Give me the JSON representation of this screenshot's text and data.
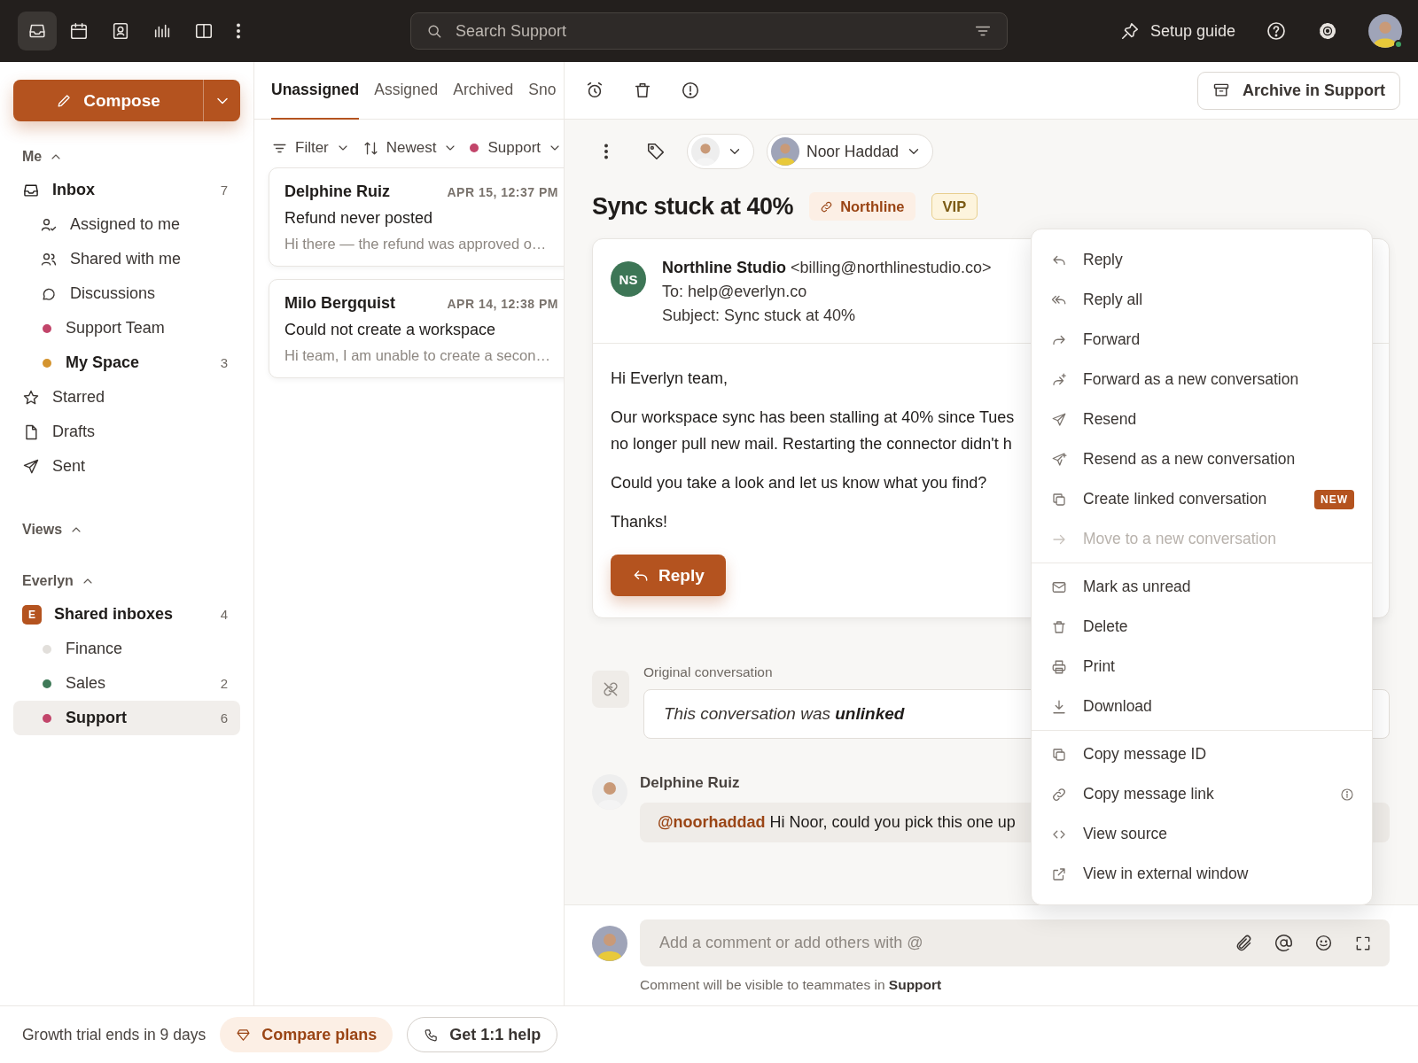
{
  "topbar": {
    "nav": [
      {
        "selected": true
      },
      {
        "selected": false
      },
      {
        "selected": false
      },
      {
        "selected": false
      },
      {
        "selected": false
      }
    ],
    "search": {
      "placeholder": "Search Support"
    },
    "setup_guide": "Setup guide",
    "user": {
      "online": true
    }
  },
  "compose": {
    "label": "Compose"
  },
  "sidebar": {
    "sections": [
      {
        "title": "Me",
        "expanded": true,
        "items": [
          {
            "label": "Inbox",
            "count": "7",
            "unread": true,
            "selected": false,
            "children": [
              {
                "label": "Assigned to me",
                "unread": false,
                "selected": false
              },
              {
                "label": "Shared with me",
                "unread": false,
                "selected": false
              },
              {
                "label": "Discussions",
                "unread": false,
                "selected": false
              },
              {
                "label": "Support Team",
                "color": "#c2456a",
                "unread": false,
                "selected": false
              },
              {
                "label": "My Space",
                "color": "#d4942f",
                "count": "3",
                "unread": true,
                "selected": false
              }
            ]
          },
          {
            "label": "Starred",
            "unread": false,
            "selected": false
          },
          {
            "label": "Drafts",
            "unread": false,
            "selected": false
          },
          {
            "label": "Sent",
            "unread": false,
            "selected": false
          }
        ]
      },
      {
        "title": "Views",
        "expanded": true
      },
      {
        "title": "Everlyn",
        "expanded": true,
        "items": [
          {
            "label": "Shared inboxes",
            "badge": "E",
            "count": "4",
            "unread": true,
            "selected": false,
            "children": [
              {
                "label": "Finance",
                "color": "#e2dfdb",
                "unread": false,
                "selected": false
              },
              {
                "label": "Sales",
                "color": "#3f7a58",
                "count": "2",
                "unread": false,
                "selected": false
              },
              {
                "label": "Support",
                "color": "#c2456a",
                "count": "6",
                "unread": true,
                "selected": true
              }
            ]
          }
        ]
      }
    ]
  },
  "list": {
    "tabs": [
      {
        "label": "Unassigned",
        "selected": true
      },
      {
        "label": "Assigned",
        "selected": false
      },
      {
        "label": "Archived",
        "selected": false
      },
      {
        "label": "Sno",
        "selected": false
      }
    ],
    "filters": [
      {
        "label": "Filter",
        "kind": "filter"
      },
      {
        "label": "Newest",
        "kind": "sort"
      },
      {
        "label": "Support",
        "kind": "inbox",
        "color": "#c2456a"
      }
    ],
    "conversations": [
      {
        "name": "Delphine Ruiz",
        "time": "APR 15, 12:37 PM",
        "subject": "Refund never posted",
        "preview": "Hi there — the refund was approved o…",
        "selected": false
      },
      {
        "name": "Milo Bergquist",
        "time": "APR 14, 12:38 PM",
        "subject": "Could not create a workspace",
        "preview": "Hi team, I am unable to create a secon…",
        "selected": false
      }
    ]
  },
  "toolbar": {
    "archive": "Archive in Support"
  },
  "conversation": {
    "assignee": "Noor Haddad",
    "title": "Sync stuck at 40%",
    "tags": [
      {
        "label": "Northline",
        "kind": "link"
      },
      {
        "label": "VIP",
        "kind": "plain"
      }
    ],
    "message": {
      "initials": "NS",
      "sender": "Northline Studio",
      "email": "<billing@northlinestudio.co>",
      "to": "To: help@everlyn.co",
      "subject": "Subject: Sync stuck at 40%",
      "body": [
        [
          "Hi Everlyn team,"
        ],
        [
          "Our workspace sync has been stalling at 40% since Tues",
          "no longer pull new mail. Restarting the connector didn't h"
        ],
        [
          "Could you take a look and let us know what you find?"
        ],
        [
          "Thanks!"
        ]
      ],
      "reply": "Reply"
    },
    "original": {
      "label": "Original conversation",
      "text": "This conversation was **unlinked**"
    },
    "comment": {
      "author": "Delphine Ruiz",
      "mention": "@noorhaddad",
      "text": "Hi Noor, could you pick this one up"
    },
    "composer": {
      "placeholder": "Add a comment or add others with @",
      "note": "Comment will be visible to teammates in **Support**"
    }
  },
  "menu": [
    [
      {
        "label": "Reply",
        "disabled": false
      },
      {
        "label": "Reply all",
        "disabled": false
      },
      {
        "label": "Forward",
        "disabled": false
      },
      {
        "label": "Forward as a new conversation",
        "disabled": false
      },
      {
        "label": "Resend",
        "disabled": false
      },
      {
        "label": "Resend as a new conversation",
        "disabled": false
      },
      {
        "label": "Create linked conversation",
        "badge": "NEW",
        "disabled": false
      },
      {
        "label": "Move to a new conversation",
        "disabled": true
      }
    ],
    [
      {
        "label": "Mark as unread",
        "disabled": false
      },
      {
        "label": "Delete",
        "disabled": false
      },
      {
        "label": "Print",
        "disabled": false
      },
      {
        "label": "Download",
        "disabled": false
      }
    ],
    [
      {
        "label": "Copy message ID",
        "disabled": false
      },
      {
        "label": "Copy message link",
        "info": true,
        "disabled": false
      },
      {
        "label": "View source",
        "disabled": false
      },
      {
        "label": "View in external window",
        "disabled": false
      }
    ]
  ],
  "footer": {
    "trial": "Growth trial ends in 9 days",
    "compare": "Compare plans",
    "help": "Get 1:1 help"
  }
}
